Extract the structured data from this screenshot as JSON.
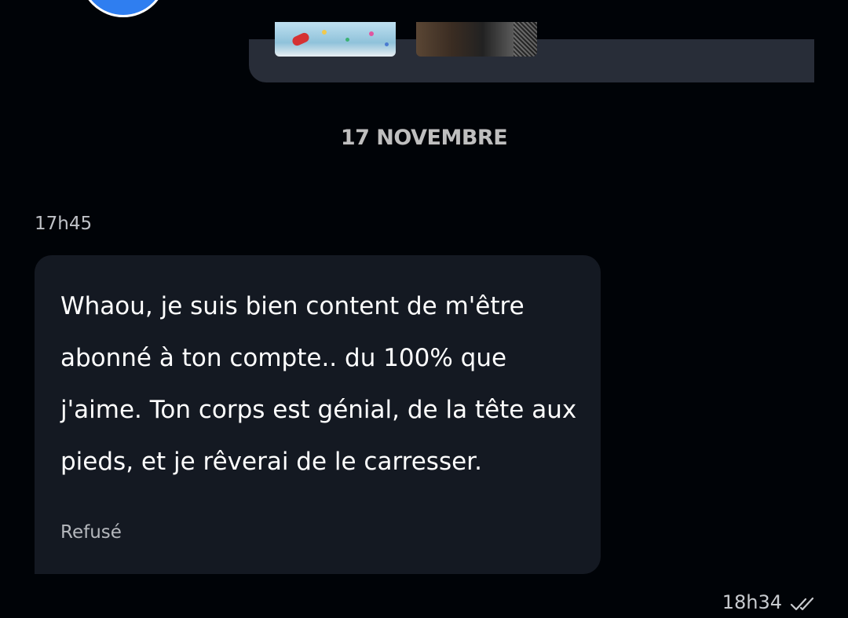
{
  "previous_message": {
    "attachments": [
      {
        "name": "photo-attachment-1"
      },
      {
        "name": "photo-attachment-2"
      }
    ]
  },
  "date_separator": "17 NOVEMBRE",
  "message": {
    "time": "17h45",
    "text": "Whaou, je suis bien content de m'être abonné à ton compte.. du 100% que j'aime. Ton corps est génial, de la tête aux pieds, et je rêverai de le carresser.",
    "status": "Refusé"
  },
  "read_receipt": {
    "time": "18h34",
    "icon": "double-check-icon"
  },
  "colors": {
    "background": "#000307",
    "incoming_bubble": "#141922",
    "outgoing_bubble": "#282d38",
    "avatar_accent": "#2f7ef0"
  }
}
